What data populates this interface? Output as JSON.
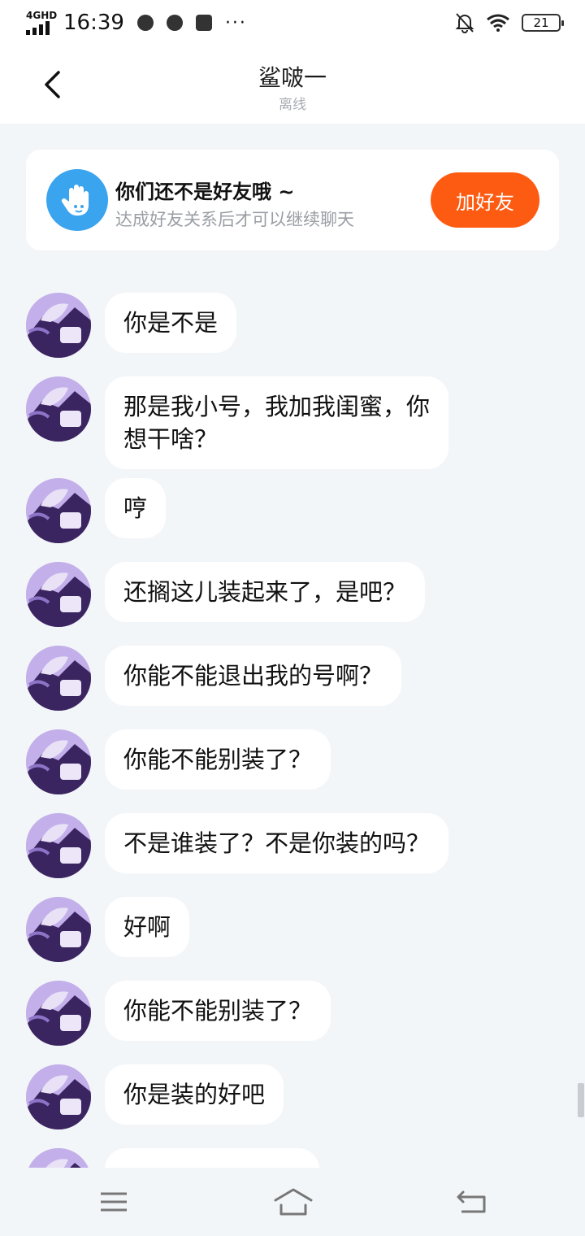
{
  "status_bar": {
    "network": "4GHD",
    "time": "16:39",
    "more": "···",
    "battery": "21"
  },
  "header": {
    "title": "鲨啵一",
    "status": "离线"
  },
  "friend_banner": {
    "title": "你们还不是好友哦 ~",
    "subtitle": "达成好友关系后才可以继续聊天",
    "button": "加好友"
  },
  "messages": [
    {
      "text": "你是不是"
    },
    {
      "text": "那是我小号，我加我闺蜜，你\n想干啥？"
    },
    {
      "text": "哼"
    },
    {
      "text": "还搁这儿装起来了，是吧？"
    },
    {
      "text": "你能不能退出我的号啊？"
    },
    {
      "text": "你能不能别装了？"
    },
    {
      "text": "不是谁装了？不是你装的吗？"
    },
    {
      "text": "好啊"
    },
    {
      "text": "你能不能别装了？"
    },
    {
      "text": "你是装的好吧"
    },
    {
      "text": ""
    }
  ],
  "colors": {
    "accent": "#fe5b12",
    "banner_icon": "#3aa4ee",
    "background": "#f3f6f9"
  }
}
